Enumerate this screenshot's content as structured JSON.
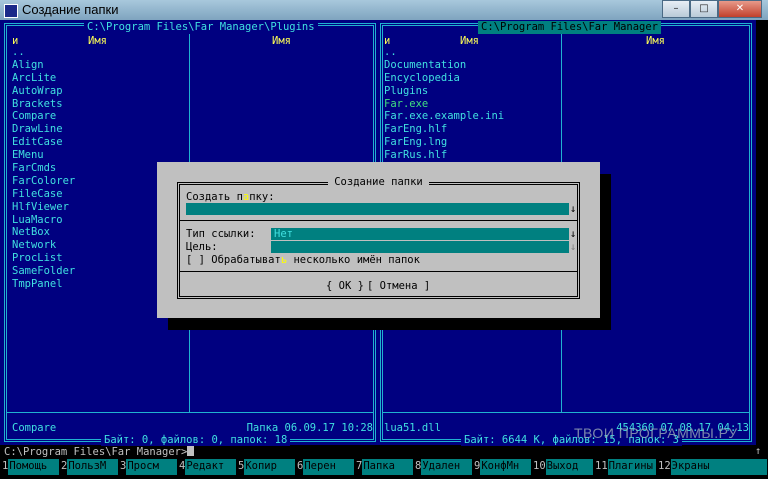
{
  "window": {
    "title": "Создание папки",
    "minimize": "–",
    "maximize": "□",
    "close": "✕"
  },
  "left_panel": {
    "path": "C:\\Program Files\\Far Manager\\Plugins",
    "col_n": "и",
    "col_name1": "Имя",
    "col_name2": "Имя",
    "files": [
      "..",
      "Align",
      "ArcLite",
      "AutoWrap",
      "Brackets",
      "Compare",
      "DrawLine",
      "EditCase",
      "EMenu",
      "FarCmds",
      "FarColorer",
      "FileCase",
      "HlfViewer",
      "LuaMacro",
      "NetBox",
      "Network",
      "ProcList",
      "SameFolder",
      "TmpPanel"
    ],
    "selected_name": "Compare",
    "selected_info": "Папка 06.09.17 10:28",
    "footer": "Байт: 0, файлов: 0, папок: 18"
  },
  "right_panel": {
    "path": "C:\\Program Files\\Far Manager",
    "col_n": "и",
    "col_name1": "Имя",
    "col_name2": "Имя",
    "files": [
      "..",
      "Documentation",
      "Encyclopedia",
      "Plugins",
      "Far.exe",
      "Far.exe.example.ini",
      "FarEng.hlf",
      "FarEng.lng",
      "FarRus.hlf"
    ],
    "selected_name": "lua51.dll",
    "selected_info": "454360 07.08.17 04:13",
    "footer": "Байт: 6644 K, файлов: 15, папок: 3"
  },
  "dialog": {
    "title": "Создание папки",
    "create_label_pre": "Создать п",
    "create_label_hot": "а",
    "create_label_post": "пку:",
    "create_value": "",
    "link_type_label": "Тип ссылки:",
    "link_type_value": "Нет",
    "target_label": "Цель:",
    "checkbox_pre": "[ ] Обрабатыват",
    "checkbox_hot": "ь",
    "checkbox_post": " несколько имён папок",
    "ok_button": "{ OK }",
    "cancel_button": "[ Отмена ]",
    "arrow": "↓"
  },
  "command_line": "C:\\Program Files\\Far Manager>",
  "scroll_up_glyph": "↑",
  "keybar": [
    {
      "n": "1",
      "label": "Помощь"
    },
    {
      "n": "2",
      "label": "ПользМ"
    },
    {
      "n": "3",
      "label": "Просм"
    },
    {
      "n": "4",
      "label": "Редакт"
    },
    {
      "n": "5",
      "label": "Копир"
    },
    {
      "n": "6",
      "label": "Перен"
    },
    {
      "n": "7",
      "label": "Папка"
    },
    {
      "n": "8",
      "label": "Удален"
    },
    {
      "n": "9",
      "label": "КонфМн"
    },
    {
      "n": "10",
      "label": "Выход"
    },
    {
      "n": "11",
      "label": "Плагины"
    },
    {
      "n": "12",
      "label": "Экраны"
    }
  ],
  "watermark": "ТВОИ ПРОГРАММЫ.РУ",
  "colors": {
    "panel_bg": "#000080",
    "text": "#40e0e0",
    "header": "#ffff55",
    "exe": "#40e080",
    "dialog_bg": "#c0c0c0",
    "field": "#008080"
  }
}
